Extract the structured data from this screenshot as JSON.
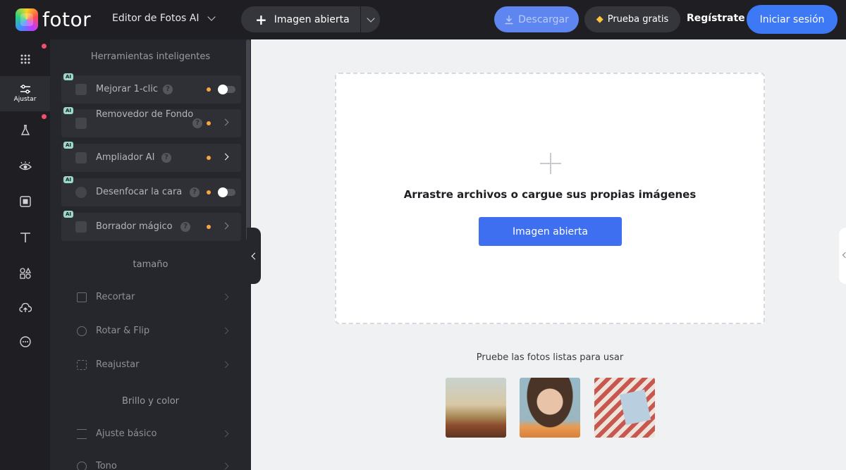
{
  "header": {
    "logo_text": "fotor",
    "editor_menu": "Editor de Fotos AI",
    "open_image": "Imagen abierta",
    "download": "Descargar",
    "trial": "Prueba gratis",
    "register": "Regístrate",
    "login": "Iniciar sesión"
  },
  "rail": {
    "items": [
      {
        "icon": "apps-grid-icon",
        "label": "",
        "dot": true
      },
      {
        "icon": "sliders-icon",
        "label": "Ajustar",
        "active": true
      },
      {
        "icon": "beaker-icon",
        "label": "",
        "dot": true
      },
      {
        "icon": "eye-icon",
        "label": ""
      },
      {
        "icon": "frame-icon",
        "label": ""
      },
      {
        "icon": "text-icon",
        "label": ""
      },
      {
        "icon": "shapes-icon",
        "label": ""
      },
      {
        "icon": "cloud-upload-icon",
        "label": ""
      },
      {
        "icon": "more-icon",
        "label": ""
      }
    ]
  },
  "panel": {
    "smart_title": "Herramientas inteligentes",
    "ai_badge": "AI",
    "smart_tools": [
      {
        "label": "Mejorar 1-clic",
        "control": "toggle"
      },
      {
        "label": "Removedor de Fondo",
        "control": "arrow"
      },
      {
        "label": "Ampliador AI",
        "control": "arrow"
      },
      {
        "label": "Desenfocar la cara",
        "control": "toggle"
      },
      {
        "label": "Borrador mágico",
        "control": "arrow"
      }
    ],
    "size_title": "tamaño",
    "size_tools": [
      "Recortar",
      "Rotar & Flip",
      "Reajustar"
    ],
    "color_title": "Brillo y color",
    "color_tools": [
      "Ajuste básico",
      "Tono"
    ]
  },
  "canvas": {
    "drop_text": "Arrastre archivos o cargue sus propias imágenes",
    "drop_button": "Imagen abierta",
    "sample_title": "Pruebe las fotos listas para usar"
  },
  "colors": {
    "accent": "#3d78f5",
    "dark_bg": "#1f1f23",
    "panel_bg": "#26272c",
    "canvas_bg": "#f0f1f3"
  }
}
